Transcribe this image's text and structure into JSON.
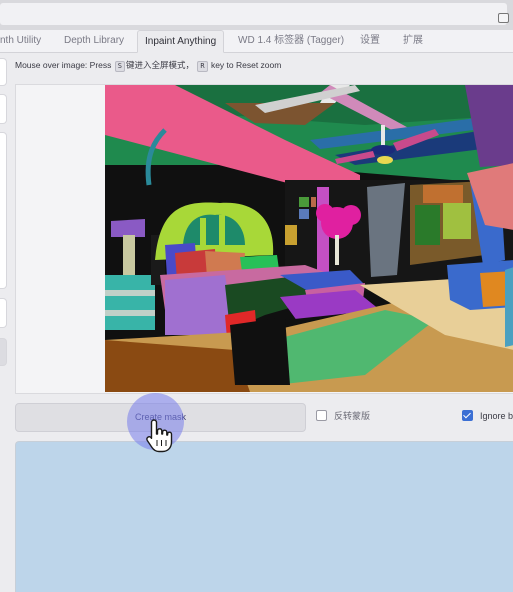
{
  "tabs": [
    {
      "label": "nth Utility",
      "active": false
    },
    {
      "label": "Depth Library",
      "active": false
    },
    {
      "label": "Inpaint Anything",
      "active": true
    },
    {
      "label": "WD 1.4 标签器 (Tagger)",
      "active": false
    },
    {
      "label": "设置",
      "active": false
    },
    {
      "label": "扩展",
      "active": false
    }
  ],
  "hint": {
    "prefix": "Mouse over image: Press",
    "key_fullscreen": "S",
    "fullscreen_text": "键进入全屏模式，",
    "key_reset": "R",
    "reset_text": "key to Reset zoom"
  },
  "create_mask_label": "Create mask",
  "invert_mask": {
    "label": "反转蒙版",
    "checked": false
  },
  "ignore_black": {
    "label": "Ignore bla",
    "checked": true
  },
  "colors": {
    "accent": "#3b6fd4",
    "mask_bg": "#bdd5ea",
    "halo": "#7a7deb"
  },
  "icons": [
    "hand-pointer-cursor-icon",
    "checkbox-icon"
  ]
}
